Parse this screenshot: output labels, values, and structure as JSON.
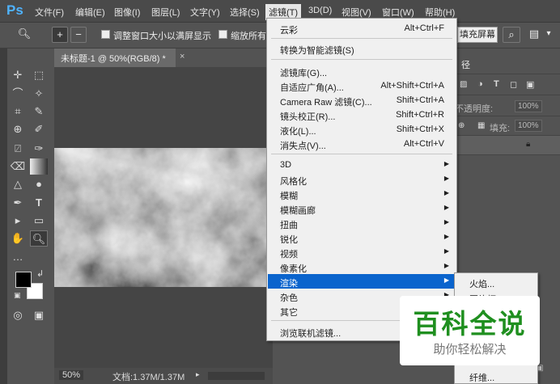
{
  "app": {
    "logo": "Ps"
  },
  "menubar": [
    "文件(F)",
    "编辑(E)",
    "图像(I)",
    "图层(L)",
    "文字(Y)",
    "选择(S)",
    "滤镜(T)",
    "3D(D)",
    "视图(V)",
    "窗口(W)",
    "帮助(H)"
  ],
  "options": {
    "resize_windows_label": "调整窗口大小以满屏显示",
    "zoom_all_label": "缩放所有",
    "fill_screen_button": "填充屏幕",
    "zoom_in_icon": "zoom-in-icon",
    "zoom_out_icon": "zoom-out-icon"
  },
  "document": {
    "tab_title": "未标题-1 @ 50%(RGB/8) *",
    "close": "×",
    "zoom": "50%",
    "doc_info": "文档:1.37M/1.37M"
  },
  "right_panel": {
    "tab_label": "径",
    "opacity_label": "不透明度:",
    "opacity_value": "100%",
    "fill_label": "填充:",
    "fill_value": "100%"
  },
  "filter_menu": {
    "items": [
      {
        "label": "云彩",
        "shortcut": "Alt+Ctrl+F"
      },
      {
        "label": "转换为智能滤镜(S)",
        "shortcut": ""
      },
      {
        "label": "滤镜库(G)...",
        "shortcut": ""
      },
      {
        "label": "自适应广角(A)...",
        "shortcut": "Alt+Shift+Ctrl+A"
      },
      {
        "label": "Camera Raw 滤镜(C)...",
        "shortcut": "Shift+Ctrl+A"
      },
      {
        "label": "镜头校正(R)...",
        "shortcut": "Shift+Ctrl+R"
      },
      {
        "label": "液化(L)...",
        "shortcut": "Shift+Ctrl+X"
      },
      {
        "label": "消失点(V)...",
        "shortcut": "Alt+Ctrl+V"
      },
      {
        "label": "3D",
        "shortcut": ""
      },
      {
        "label": "风格化",
        "shortcut": ""
      },
      {
        "label": "模糊",
        "shortcut": ""
      },
      {
        "label": "模糊画廊",
        "shortcut": ""
      },
      {
        "label": "扭曲",
        "shortcut": ""
      },
      {
        "label": "锐化",
        "shortcut": ""
      },
      {
        "label": "视频",
        "shortcut": ""
      },
      {
        "label": "像素化",
        "shortcut": ""
      },
      {
        "label": "渲染",
        "shortcut": ""
      },
      {
        "label": "杂色",
        "shortcut": ""
      },
      {
        "label": "其它",
        "shortcut": ""
      },
      {
        "label": "浏览联机滤镜...",
        "shortcut": ""
      }
    ]
  },
  "render_submenu": {
    "items": [
      "火焰...",
      "图片框...",
      "纤维..."
    ]
  },
  "watermark": {
    "title": "百科全说",
    "subtitle": "助你轻松解决"
  },
  "colors": {
    "accent": "#0a64cd",
    "watermark_green": "#1f8f1f",
    "ps_blue": "#4fb3ff"
  }
}
